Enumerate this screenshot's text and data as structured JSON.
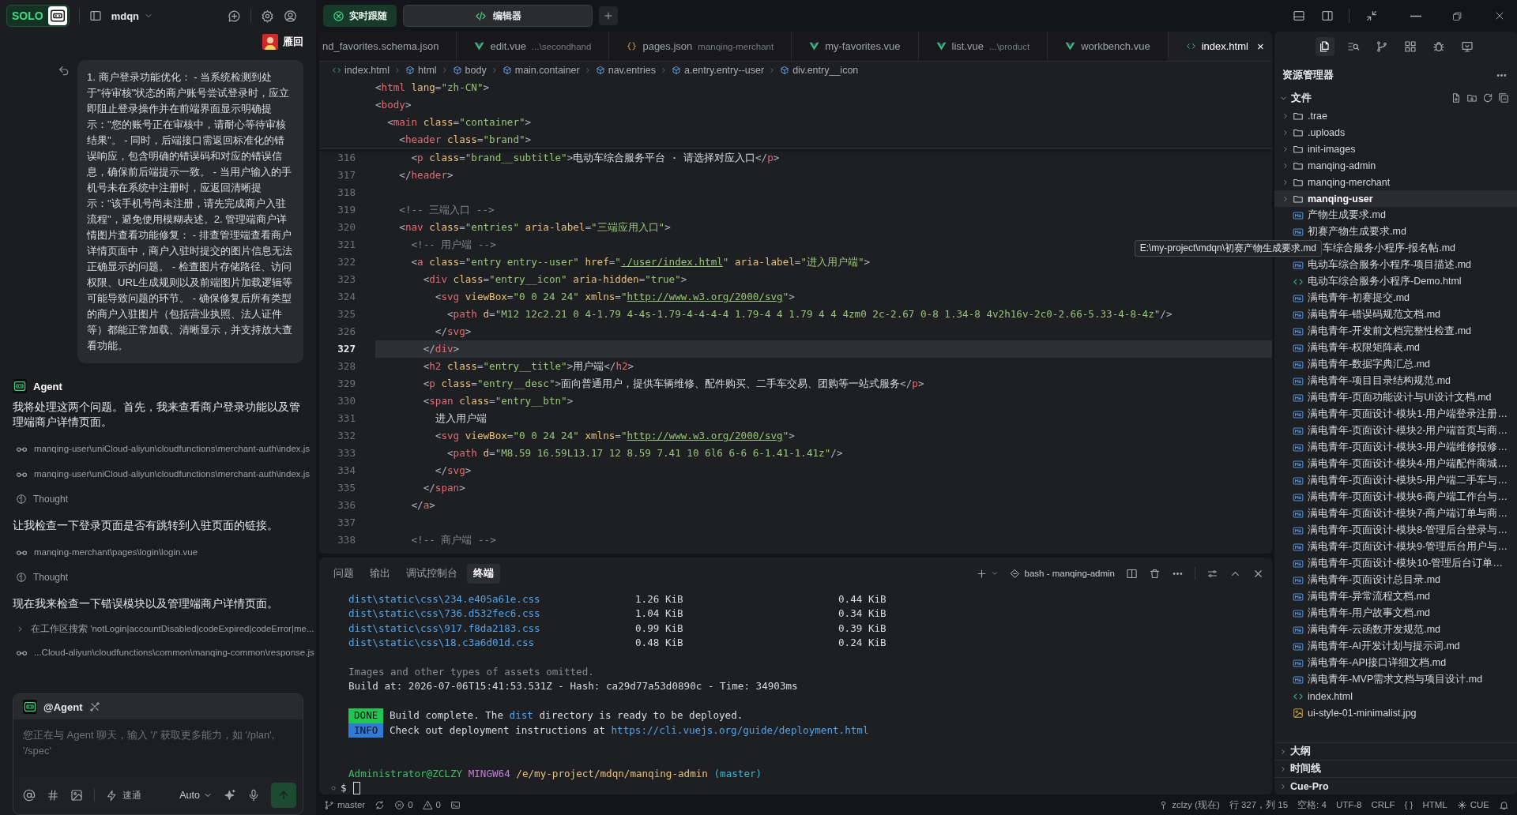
{
  "top_bar": {
    "follow_button": {
      "label": "实时跟随",
      "on": true
    },
    "view_tabs": [
      {
        "label": "编辑器",
        "selected": true
      }
    ]
  },
  "agent_panel": {
    "badge": "SOLO",
    "project": "mdqn",
    "user": {
      "name": "雁回"
    },
    "user_message": "1. 商户登录功能优化：   - 当系统检测到处于\"待审核\"状态的商户账号尝试登录时，应立即阻止登录操作并在前端界面显示明确提示：\"您的账号正在审核中，请耐心等待审核结果\"。   - 同时，后端接口需返回标准化的错误响应，包含明确的错误码和对应的错误信息，确保前后端提示一致。   - 当用户输入的手机号未在系统中注册时，应返回清晰提示：\"该手机号尚未注册，请先完成商户入驻流程\"，避免使用模糊表述。2. 管理端商户详情图片查看功能修复：   - 排查管理端查看商户详情页面中，商户入驻时提交的图片信息无法正确显示的问题。   - 检查图片存储路径、访问权限、URL生成规则以及前端图片加载逻辑等可能导致问题的环节。   - 确保修复后所有类型的商户入驻图片（包括营业执照、法人证件等）都能正常加载、清晰显示，并支持放大查看功能。",
    "agent_name": "Agent",
    "entries": [
      {
        "kind": "text",
        "text": "我将处理这两个问题。首先，我来查看商户登录功能以及管理端商户详情页面。"
      },
      {
        "kind": "read",
        "text": "manqing-user\\uniCloud-aliyun\\cloudfunctions\\merchant-auth\\index.js"
      },
      {
        "kind": "read",
        "text": "manqing-user\\uniCloud-aliyun\\cloudfunctions\\merchant-auth\\index.js"
      },
      {
        "kind": "thought",
        "text": "Thought"
      },
      {
        "kind": "text",
        "text": "让我检查一下登录页面是否有跳转到入驻页面的链接。"
      },
      {
        "kind": "read",
        "text": "manqing-merchant\\pages\\login\\login.vue"
      },
      {
        "kind": "thought",
        "text": "Thought"
      },
      {
        "kind": "text",
        "text": "现在我来检查一下错误模块以及管理端商户详情页面。"
      },
      {
        "kind": "search",
        "text": "在工作区搜索 'notLogin|accountDisabled|codeExpired|codeError|me...",
        "expanded": false
      },
      {
        "kind": "read",
        "text": "...Cloud-aliyun\\cloudfunctions\\common\\manqing-common\\response.js"
      }
    ],
    "composer": {
      "mention": "@Agent",
      "placeholder": "您正在与 Agent 聊天，输入 '/' 获取更多能力，如 '/plan', '/spec'",
      "mode": "速通",
      "model": "Auto"
    }
  },
  "editor": {
    "tabs": [
      {
        "label": "nd_favorites.schema.json",
        "selected": false
      },
      {
        "label": "edit.vue",
        "detail": "...\\secondhand",
        "kind": "vue",
        "selected": false
      },
      {
        "label": "pages.json",
        "detail": "manqing-merchant",
        "kind": "json",
        "selected": false
      },
      {
        "label": "my-favorites.vue",
        "kind": "vue",
        "selected": false
      },
      {
        "label": "list.vue",
        "detail": "...\\product",
        "kind": "vue",
        "selected": false
      },
      {
        "label": "workbench.vue",
        "kind": "vue",
        "selected": false
      },
      {
        "label": "index.html",
        "kind": "html",
        "selected": true,
        "close": "×"
      }
    ],
    "breadcrumb": [
      {
        "label": "index.html",
        "kind": "file"
      },
      {
        "label": "html",
        "kind": "element"
      },
      {
        "label": "body",
        "kind": "element"
      },
      {
        "label": "main.container",
        "kind": "element"
      },
      {
        "label": "nav.entries",
        "kind": "element"
      },
      {
        "label": "a.entry.entry--user",
        "kind": "element"
      },
      {
        "label": "div.entry__icon",
        "kind": "element"
      }
    ],
    "sticky_lines": [
      [
        {
          "kind": "b",
          "text": "<"
        },
        {
          "kind": "tag",
          "text": "html"
        },
        {
          "kind": "attr",
          "text": " lang"
        },
        {
          "kind": "b",
          "text": "="
        },
        {
          "kind": "str",
          "text": "\"zh-CN\""
        },
        {
          "kind": "b",
          "text": ">"
        }
      ],
      [
        {
          "kind": "b",
          "text": "<"
        },
        {
          "kind": "tag",
          "text": "body"
        },
        {
          "kind": "b",
          "text": ">"
        }
      ],
      [
        {
          "kind": "b",
          "text": "  <"
        },
        {
          "kind": "tag",
          "text": "main"
        },
        {
          "kind": "attr",
          "text": " class"
        },
        {
          "kind": "b",
          "text": "="
        },
        {
          "kind": "str",
          "text": "\"container\""
        },
        {
          "kind": "b",
          "text": ">"
        }
      ],
      [
        {
          "kind": "b",
          "text": "    <"
        },
        {
          "kind": "tag",
          "text": "header"
        },
        {
          "kind": "attr",
          "text": " class"
        },
        {
          "kind": "b",
          "text": "="
        },
        {
          "kind": "str",
          "text": "\"brand\""
        },
        {
          "kind": "b",
          "text": ">"
        }
      ]
    ],
    "lines": [
      {
        "number": "316",
        "current": false,
        "tokens": [
          {
            "kind": "b",
            "text": "      <"
          },
          {
            "kind": "tag",
            "text": "p"
          },
          {
            "kind": "attr",
            "text": " class"
          },
          {
            "kind": "b",
            "text": "="
          },
          {
            "kind": "str",
            "text": "\"brand__subtitle\""
          },
          {
            "kind": "b",
            "text": ">"
          },
          {
            "kind": "txt",
            "text": "电动车综合服务平台 · 请选择对应入口"
          },
          {
            "kind": "b",
            "text": "</"
          },
          {
            "kind": "tag",
            "text": "p"
          },
          {
            "kind": "b",
            "text": ">"
          }
        ]
      },
      {
        "number": "317",
        "current": false,
        "tokens": [
          {
            "kind": "b",
            "text": "    </"
          },
          {
            "kind": "tag",
            "text": "header"
          },
          {
            "kind": "b",
            "text": ">"
          }
        ]
      },
      {
        "number": "318",
        "current": false
      },
      {
        "number": "319",
        "current": false,
        "tokens": [
          {
            "kind": "cm",
            "text": "    <!-- 三端入口 -->"
          }
        ]
      },
      {
        "number": "320",
        "current": false,
        "tokens": [
          {
            "kind": "b",
            "text": "    <"
          },
          {
            "kind": "tag",
            "text": "nav"
          },
          {
            "kind": "attr",
            "text": " class"
          },
          {
            "kind": "b",
            "text": "="
          },
          {
            "kind": "str",
            "text": "\"entries\""
          },
          {
            "kind": "attr",
            "text": " aria-label"
          },
          {
            "kind": "b",
            "text": "="
          },
          {
            "kind": "str",
            "text": "\"三端应用入口\""
          },
          {
            "kind": "b",
            "text": ">"
          }
        ]
      },
      {
        "number": "321",
        "current": false,
        "tokens": [
          {
            "kind": "cm",
            "text": "      <!-- 用户端 -->"
          }
        ]
      },
      {
        "number": "322",
        "current": false,
        "tokens": [
          {
            "kind": "b",
            "text": "      <"
          },
          {
            "kind": "tag",
            "text": "a"
          },
          {
            "kind": "attr",
            "text": " class"
          },
          {
            "kind": "b",
            "text": "="
          },
          {
            "kind": "str",
            "text": "\"entry entry--user\""
          },
          {
            "kind": "attr",
            "text": " href"
          },
          {
            "kind": "b",
            "text": "="
          },
          {
            "kind": "str",
            "text": "\""
          },
          {
            "kind": "url",
            "text": "./user/index.html"
          },
          {
            "kind": "str",
            "text": "\""
          },
          {
            "kind": "attr",
            "text": " aria-label"
          },
          {
            "kind": "b",
            "text": "="
          },
          {
            "kind": "str",
            "text": "\"进入用户端\""
          },
          {
            "kind": "b",
            "text": ">"
          }
        ]
      },
      {
        "number": "323",
        "current": false,
        "tokens": [
          {
            "kind": "b",
            "text": "        <"
          },
          {
            "kind": "tag",
            "text": "div"
          },
          {
            "kind": "attr",
            "text": " class"
          },
          {
            "kind": "b",
            "text": "="
          },
          {
            "kind": "str",
            "text": "\"entry__icon\""
          },
          {
            "kind": "attr",
            "text": " aria-hidden"
          },
          {
            "kind": "b",
            "text": "="
          },
          {
            "kind": "str",
            "text": "\"true\""
          },
          {
            "kind": "b",
            "text": ">"
          }
        ]
      },
      {
        "number": "324",
        "current": false,
        "tokens": [
          {
            "kind": "b",
            "text": "          <"
          },
          {
            "kind": "tag",
            "text": "svg"
          },
          {
            "kind": "attr",
            "text": " viewBox"
          },
          {
            "kind": "b",
            "text": "="
          },
          {
            "kind": "str",
            "text": "\"0 0 24 24\""
          },
          {
            "kind": "attr",
            "text": " xmlns"
          },
          {
            "kind": "b",
            "text": "="
          },
          {
            "kind": "str",
            "text": "\""
          },
          {
            "kind": "url",
            "text": "http://www.w3.org/2000/svg"
          },
          {
            "kind": "str",
            "text": "\""
          },
          {
            "kind": "b",
            "text": ">"
          }
        ]
      },
      {
        "number": "325",
        "current": false,
        "tokens": [
          {
            "kind": "b",
            "text": "            <"
          },
          {
            "kind": "tag",
            "text": "path"
          },
          {
            "kind": "attr",
            "text": " d"
          },
          {
            "kind": "b",
            "text": "="
          },
          {
            "kind": "str",
            "text": "\"M12 12c2.21 0 4-1.79 4-4s-1.79-4-4-4-4 1.79-4 4 1.79 4 4 4zm0 2c-2.67 0-8 1.34-8 4v2h16v-2c0-2.66-5.33-4-8-4z\""
          },
          {
            "kind": "b",
            "text": "/>"
          }
        ]
      },
      {
        "number": "326",
        "current": false,
        "tokens": [
          {
            "kind": "b",
            "text": "          </"
          },
          {
            "kind": "tag",
            "text": "svg"
          },
          {
            "kind": "b",
            "text": ">"
          }
        ]
      },
      {
        "number": "327",
        "current": true,
        "tokens": [
          {
            "kind": "b",
            "text": "        </"
          },
          {
            "kind": "tag",
            "text": "div"
          },
          {
            "kind": "b",
            "text": ">"
          }
        ]
      },
      {
        "number": "328",
        "current": false,
        "tokens": [
          {
            "kind": "b",
            "text": "        <"
          },
          {
            "kind": "tag",
            "text": "h2"
          },
          {
            "kind": "attr",
            "text": " class"
          },
          {
            "kind": "b",
            "text": "="
          },
          {
            "kind": "str",
            "text": "\"entry__title\""
          },
          {
            "kind": "b",
            "text": ">"
          },
          {
            "kind": "txt",
            "text": "用户端"
          },
          {
            "kind": "b",
            "text": "</"
          },
          {
            "kind": "tag",
            "text": "h2"
          },
          {
            "kind": "b",
            "text": ">"
          }
        ]
      },
      {
        "number": "329",
        "current": false,
        "tokens": [
          {
            "kind": "b",
            "text": "        <"
          },
          {
            "kind": "tag",
            "text": "p"
          },
          {
            "kind": "attr",
            "text": " class"
          },
          {
            "kind": "b",
            "text": "="
          },
          {
            "kind": "str",
            "text": "\"entry__desc\""
          },
          {
            "kind": "b",
            "text": ">"
          },
          {
            "kind": "txt",
            "text": "面向普通用户，提供车辆维修、配件购买、二手车交易、团购等一站式服务"
          },
          {
            "kind": "b",
            "text": "</"
          },
          {
            "kind": "tag",
            "text": "p"
          },
          {
            "kind": "b",
            "text": ">"
          }
        ]
      },
      {
        "number": "330",
        "current": false,
        "tokens": [
          {
            "kind": "b",
            "text": "        <"
          },
          {
            "kind": "tag",
            "text": "span"
          },
          {
            "kind": "attr",
            "text": " class"
          },
          {
            "kind": "b",
            "text": "="
          },
          {
            "kind": "str",
            "text": "\"entry__btn\""
          },
          {
            "kind": "b",
            "text": ">"
          }
        ]
      },
      {
        "number": "331",
        "current": false,
        "tokens": [
          {
            "kind": "txt",
            "text": "          进入用户端"
          }
        ]
      },
      {
        "number": "332",
        "current": false,
        "tokens": [
          {
            "kind": "b",
            "text": "          <"
          },
          {
            "kind": "tag",
            "text": "svg"
          },
          {
            "kind": "attr",
            "text": " viewBox"
          },
          {
            "kind": "b",
            "text": "="
          },
          {
            "kind": "str",
            "text": "\"0 0 24 24\""
          },
          {
            "kind": "attr",
            "text": " xmlns"
          },
          {
            "kind": "b",
            "text": "="
          },
          {
            "kind": "str",
            "text": "\""
          },
          {
            "kind": "url",
            "text": "http://www.w3.org/2000/svg"
          },
          {
            "kind": "str",
            "text": "\""
          },
          {
            "kind": "b",
            "text": ">"
          }
        ]
      },
      {
        "number": "333",
        "current": false,
        "tokens": [
          {
            "kind": "b",
            "text": "            <"
          },
          {
            "kind": "tag",
            "text": "path"
          },
          {
            "kind": "attr",
            "text": " d"
          },
          {
            "kind": "b",
            "text": "="
          },
          {
            "kind": "str",
            "text": "\"M8.59 16.59L13.17 12 8.59 7.41 10 6l6 6-6 6-1.41-1.41z\""
          },
          {
            "kind": "b",
            "text": "/>"
          }
        ]
      },
      {
        "number": "334",
        "current": false,
        "tokens": [
          {
            "kind": "b",
            "text": "          </"
          },
          {
            "kind": "tag",
            "text": "svg"
          },
          {
            "kind": "b",
            "text": ">"
          }
        ]
      },
      {
        "number": "335",
        "current": false,
        "tokens": [
          {
            "kind": "b",
            "text": "        </"
          },
          {
            "kind": "tag",
            "text": "span"
          },
          {
            "kind": "b",
            "text": ">"
          }
        ]
      },
      {
        "number": "336",
        "current": false,
        "tokens": [
          {
            "kind": "b",
            "text": "      </"
          },
          {
            "kind": "tag",
            "text": "a"
          },
          {
            "kind": "b",
            "text": ">"
          }
        ]
      },
      {
        "number": "337",
        "current": false
      },
      {
        "number": "338",
        "current": false,
        "tokens": [
          {
            "kind": "cm",
            "text": "      <!-- 商户端 -->"
          }
        ]
      }
    ]
  },
  "terminal": {
    "tabs": [
      {
        "label": "问题",
        "selected": false
      },
      {
        "label": "输出",
        "selected": false
      },
      {
        "label": "调试控制台",
        "selected": false
      },
      {
        "label": "终端",
        "selected": true
      }
    ],
    "session": "bash - manqing-admin",
    "lines": [
      {
        "kind": "asset",
        "cells": [
          "dist\\static\\css\\234.e405a61e.css",
          "1.26 KiB",
          "0.44 KiB"
        ]
      },
      {
        "kind": "asset",
        "cells": [
          "dist\\static\\css\\736.d532fec6.css",
          "1.04 KiB",
          "0.34 KiB"
        ]
      },
      {
        "kind": "asset",
        "cells": [
          "dist\\static\\css\\917.f8da2183.css",
          "0.99 KiB",
          "0.39 KiB"
        ]
      },
      {
        "kind": "asset",
        "cells": [
          "dist\\static\\css\\18.c3a6d01d.css",
          "0.48 KiB",
          "0.24 KiB"
        ]
      },
      {
        "kind": "blank"
      },
      {
        "kind": "text",
        "tokens": [
          {
            "kind": "dim",
            "text": "Images and other types of assets omitted."
          }
        ]
      },
      {
        "kind": "text",
        "tokens": [
          {
            "kind": "txt",
            "text": "Build at: 2026-07-06T15:41:53.531Z - Hash: ca29d77a53d0890c - Time: 34903ms"
          }
        ]
      },
      {
        "kind": "blank"
      },
      {
        "kind": "text",
        "tokens": [
          {
            "kind": "done",
            "text": "DONE"
          },
          {
            "kind": "txt",
            "text": " Build complete. The "
          },
          {
            "kind": "blue",
            "text": "dist"
          },
          {
            "kind": "txt",
            "text": " directory is ready to be deployed."
          }
        ]
      },
      {
        "kind": "text",
        "tokens": [
          {
            "kind": "info",
            "text": "INFO"
          },
          {
            "kind": "txt",
            "text": " Check out deployment instructions at "
          },
          {
            "kind": "link",
            "text": "https://cli.vuejs.org/guide/deployment.html"
          }
        ]
      },
      {
        "kind": "blank"
      },
      {
        "kind": "blank"
      },
      {
        "kind": "text",
        "tokens": [
          {
            "kind": "user",
            "text": "Administrator@ZCLZY"
          },
          {
            "kind": "host",
            "text": " MINGW64"
          },
          {
            "kind": "cwd",
            "text": " /e/my-project/mdqn/manqing-admin"
          },
          {
            "kind": "branch",
            "text": " (master)"
          }
        ]
      },
      {
        "kind": "input",
        "prompt": "$"
      }
    ]
  },
  "explorer": {
    "title": "资源管理器",
    "section": {
      "label": "文件",
      "expanded": true
    },
    "items": [
      {
        "label": ".trae",
        "kind": "folder",
        "expanded": false,
        "selected": false
      },
      {
        "label": ".uploads",
        "kind": "folder",
        "expanded": false,
        "selected": false
      },
      {
        "label": "init-images",
        "kind": "folder",
        "expanded": false,
        "selected": false
      },
      {
        "label": "manqing-admin",
        "kind": "folder",
        "expanded": false,
        "selected": false
      },
      {
        "label": "manqing-merchant",
        "kind": "folder",
        "expanded": false,
        "selected": false
      },
      {
        "label": "manqing-user",
        "kind": "folder",
        "expanded": false,
        "selected": true
      },
      {
        "label": "产物生成要求.md",
        "kind": "md",
        "selected": false
      },
      {
        "label": "初赛产物生成要求.md",
        "kind": "md",
        "selected": false,
        "tooltip": "E:\\my-project\\mdqn\\初赛产物生成要求.md"
      },
      {
        "label": "车综合服务小程序-报名帖.md",
        "kind": "covered",
        "selected": false
      },
      {
        "label": "电动车综合服务小程序-项目描述.md",
        "kind": "md",
        "selected": false
      },
      {
        "label": "电动车综合服务小程序-Demo.html",
        "kind": "html",
        "selected": false
      },
      {
        "label": "满电青年-初赛提交.md",
        "kind": "md",
        "selected": false
      },
      {
        "label": "满电青年-错误码规范文档.md",
        "kind": "md",
        "selected": false
      },
      {
        "label": "满电青年-开发前文档完整性检查.md",
        "kind": "md",
        "selected": false
      },
      {
        "label": "满电青年-权限矩阵表.md",
        "kind": "md",
        "selected": false
      },
      {
        "label": "满电青年-数据字典汇总.md",
        "kind": "md",
        "selected": false
      },
      {
        "label": "满电青年-项目目录结构规范.md",
        "kind": "md",
        "selected": false
      },
      {
        "label": "满电青年-页面功能设计与UI设计文档.md",
        "kind": "md",
        "selected": false
      },
      {
        "label": "满电青年-页面设计-模块1-用户端登录注册…",
        "kind": "md",
        "selected": false
      },
      {
        "label": "满电青年-页面设计-模块2-用户端首页与商…",
        "kind": "md",
        "selected": false
      },
      {
        "label": "满电青年-页面设计-模块3-用户端维修报修…",
        "kind": "md",
        "selected": false
      },
      {
        "label": "满电青年-页面设计-模块4-用户端配件商城…",
        "kind": "md",
        "selected": false
      },
      {
        "label": "满电青年-页面设计-模块5-用户端二手车与…",
        "kind": "md",
        "selected": false
      },
      {
        "label": "满电青年-页面设计-模块6-商户端工作台与…",
        "kind": "md",
        "selected": false
      },
      {
        "label": "满电青年-页面设计-模块7-商户端订单与商…",
        "kind": "md",
        "selected": false
      },
      {
        "label": "满电青年-页面设计-模块8-管理后台登录与…",
        "kind": "md",
        "selected": false
      },
      {
        "label": "满电青年-页面设计-模块9-管理后台用户与…",
        "kind": "md",
        "selected": false
      },
      {
        "label": "满电青年-页面设计-模块10-管理后台订单…",
        "kind": "md",
        "selected": false
      },
      {
        "label": "满电青年-页面设计总目录.md",
        "kind": "md",
        "selected": false
      },
      {
        "label": "满电青年-异常流程文档.md",
        "kind": "md",
        "selected": false
      },
      {
        "label": "满电青年-用户故事文档.md",
        "kind": "md",
        "selected": false
      },
      {
        "label": "满电青年-云函数开发规范.md",
        "kind": "md",
        "selected": false
      },
      {
        "label": "满电青年-AI开发计划与提示词.md",
        "kind": "md",
        "selected": false
      },
      {
        "label": "满电青年-API接口详细文档.md",
        "kind": "md",
        "selected": false
      },
      {
        "label": "满电青年-MVP需求文档与项目设计.md",
        "kind": "md",
        "selected": false
      },
      {
        "label": "index.html",
        "kind": "html",
        "selected": false
      },
      {
        "label": "ui-style-01-minimalist.jpg",
        "kind": "image",
        "selected": false
      }
    ],
    "sections": [
      {
        "label": "大纲",
        "expanded": false
      },
      {
        "label": "时间线",
        "expanded": false
      },
      {
        "label": "Cue-Pro",
        "expanded": false
      }
    ]
  },
  "status_bar": {
    "left": [
      {
        "kind": "branch",
        "label": "master"
      },
      {
        "kind": "sync"
      },
      {
        "kind": "errors",
        "label": "0"
      },
      {
        "kind": "warnings",
        "label": "0"
      },
      {
        "kind": "terminal"
      }
    ],
    "right": [
      {
        "kind": "user",
        "label": "zclzy (现在)"
      },
      {
        "kind": "text",
        "label": "行 327，列 15"
      },
      {
        "kind": "text",
        "label": "空格: 4"
      },
      {
        "kind": "text",
        "label": "UTF-8"
      },
      {
        "kind": "text",
        "label": "CRLF"
      },
      {
        "kind": "text",
        "label": "{ }"
      },
      {
        "kind": "text",
        "label": "HTML"
      },
      {
        "kind": "cue",
        "label": "CUE"
      },
      {
        "kind": "bell"
      }
    ]
  }
}
